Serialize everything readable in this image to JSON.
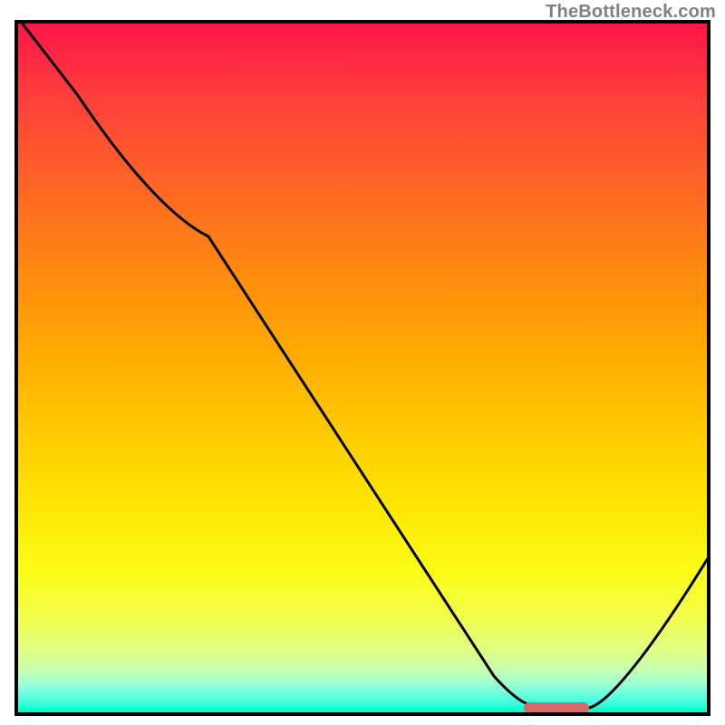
{
  "watermark": "TheBottleneck.com",
  "chart_data": {
    "type": "line",
    "title": "",
    "xlabel": "",
    "ylabel": "",
    "xlim": [
      0,
      100
    ],
    "ylim": [
      0,
      100
    ],
    "grid": false,
    "x": [
      0,
      5,
      15,
      25,
      35,
      45,
      55,
      65,
      70,
      75,
      78,
      82,
      86,
      90,
      94,
      100
    ],
    "values": [
      100,
      92,
      80,
      72,
      60,
      48,
      36,
      24,
      18,
      12,
      6,
      2,
      0,
      0,
      4,
      22
    ],
    "marker": {
      "x_start": 73.5,
      "x_end": 82.5,
      "y": 0.6
    },
    "background_gradient_stops": [
      {
        "pct": 0,
        "color": "#fc1648"
      },
      {
        "pct": 50,
        "color": "#ffb300"
      },
      {
        "pct": 80,
        "color": "#fafd19"
      },
      {
        "pct": 100,
        "color": "#00ffc0"
      }
    ]
  }
}
